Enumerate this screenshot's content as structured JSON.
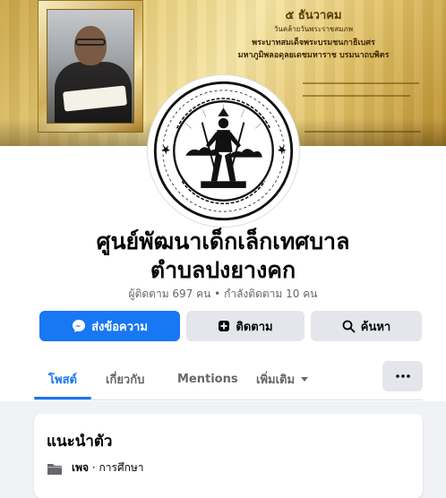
{
  "cover": {
    "line1": "๕ ธันวาคม",
    "line2": "วันคล้ายวันพระราชสมภพ",
    "line3": "พระบาทสมเด็จพระบรมชนกาธิเบศร",
    "line4": "มหาภูมิพลอดุลยเดชมหาราช บรมนาถบพิตร"
  },
  "profile": {
    "name_line1": "ศูนย์พัฒนาเด็กเล็กเทศบาล",
    "name_line2": "ตำบลปงยางคก",
    "followers": "ผู้ติดตาม 697 คน • กำลังติดตาม 10 คน"
  },
  "actions": {
    "message_label": "ส่งข้อความ",
    "follow_label": "ติดตาม",
    "search_label": "ค้นหา"
  },
  "tabs": [
    {
      "label": "โพสต์",
      "active": true
    },
    {
      "label": "เกี่ยวกับ",
      "active": false
    },
    {
      "label": "Mentions",
      "active": false
    },
    {
      "label": "เพิ่มเติม",
      "active": false
    }
  ],
  "intro": {
    "title": "แนะนำตัว",
    "category_prefix": "เพจ",
    "category_sep": " · ",
    "category": "การศึกษา"
  },
  "colors": {
    "accent": "#1877f2",
    "secondary_button": "#e4e6eb",
    "muted_text": "#65676b"
  },
  "icons": {
    "message": "messenger-icon",
    "follow": "follow-add-icon",
    "search": "search-icon",
    "more_tab": "chevron-down-icon",
    "tab_overflow": "more-dots-icon",
    "category": "page-category-icon"
  }
}
